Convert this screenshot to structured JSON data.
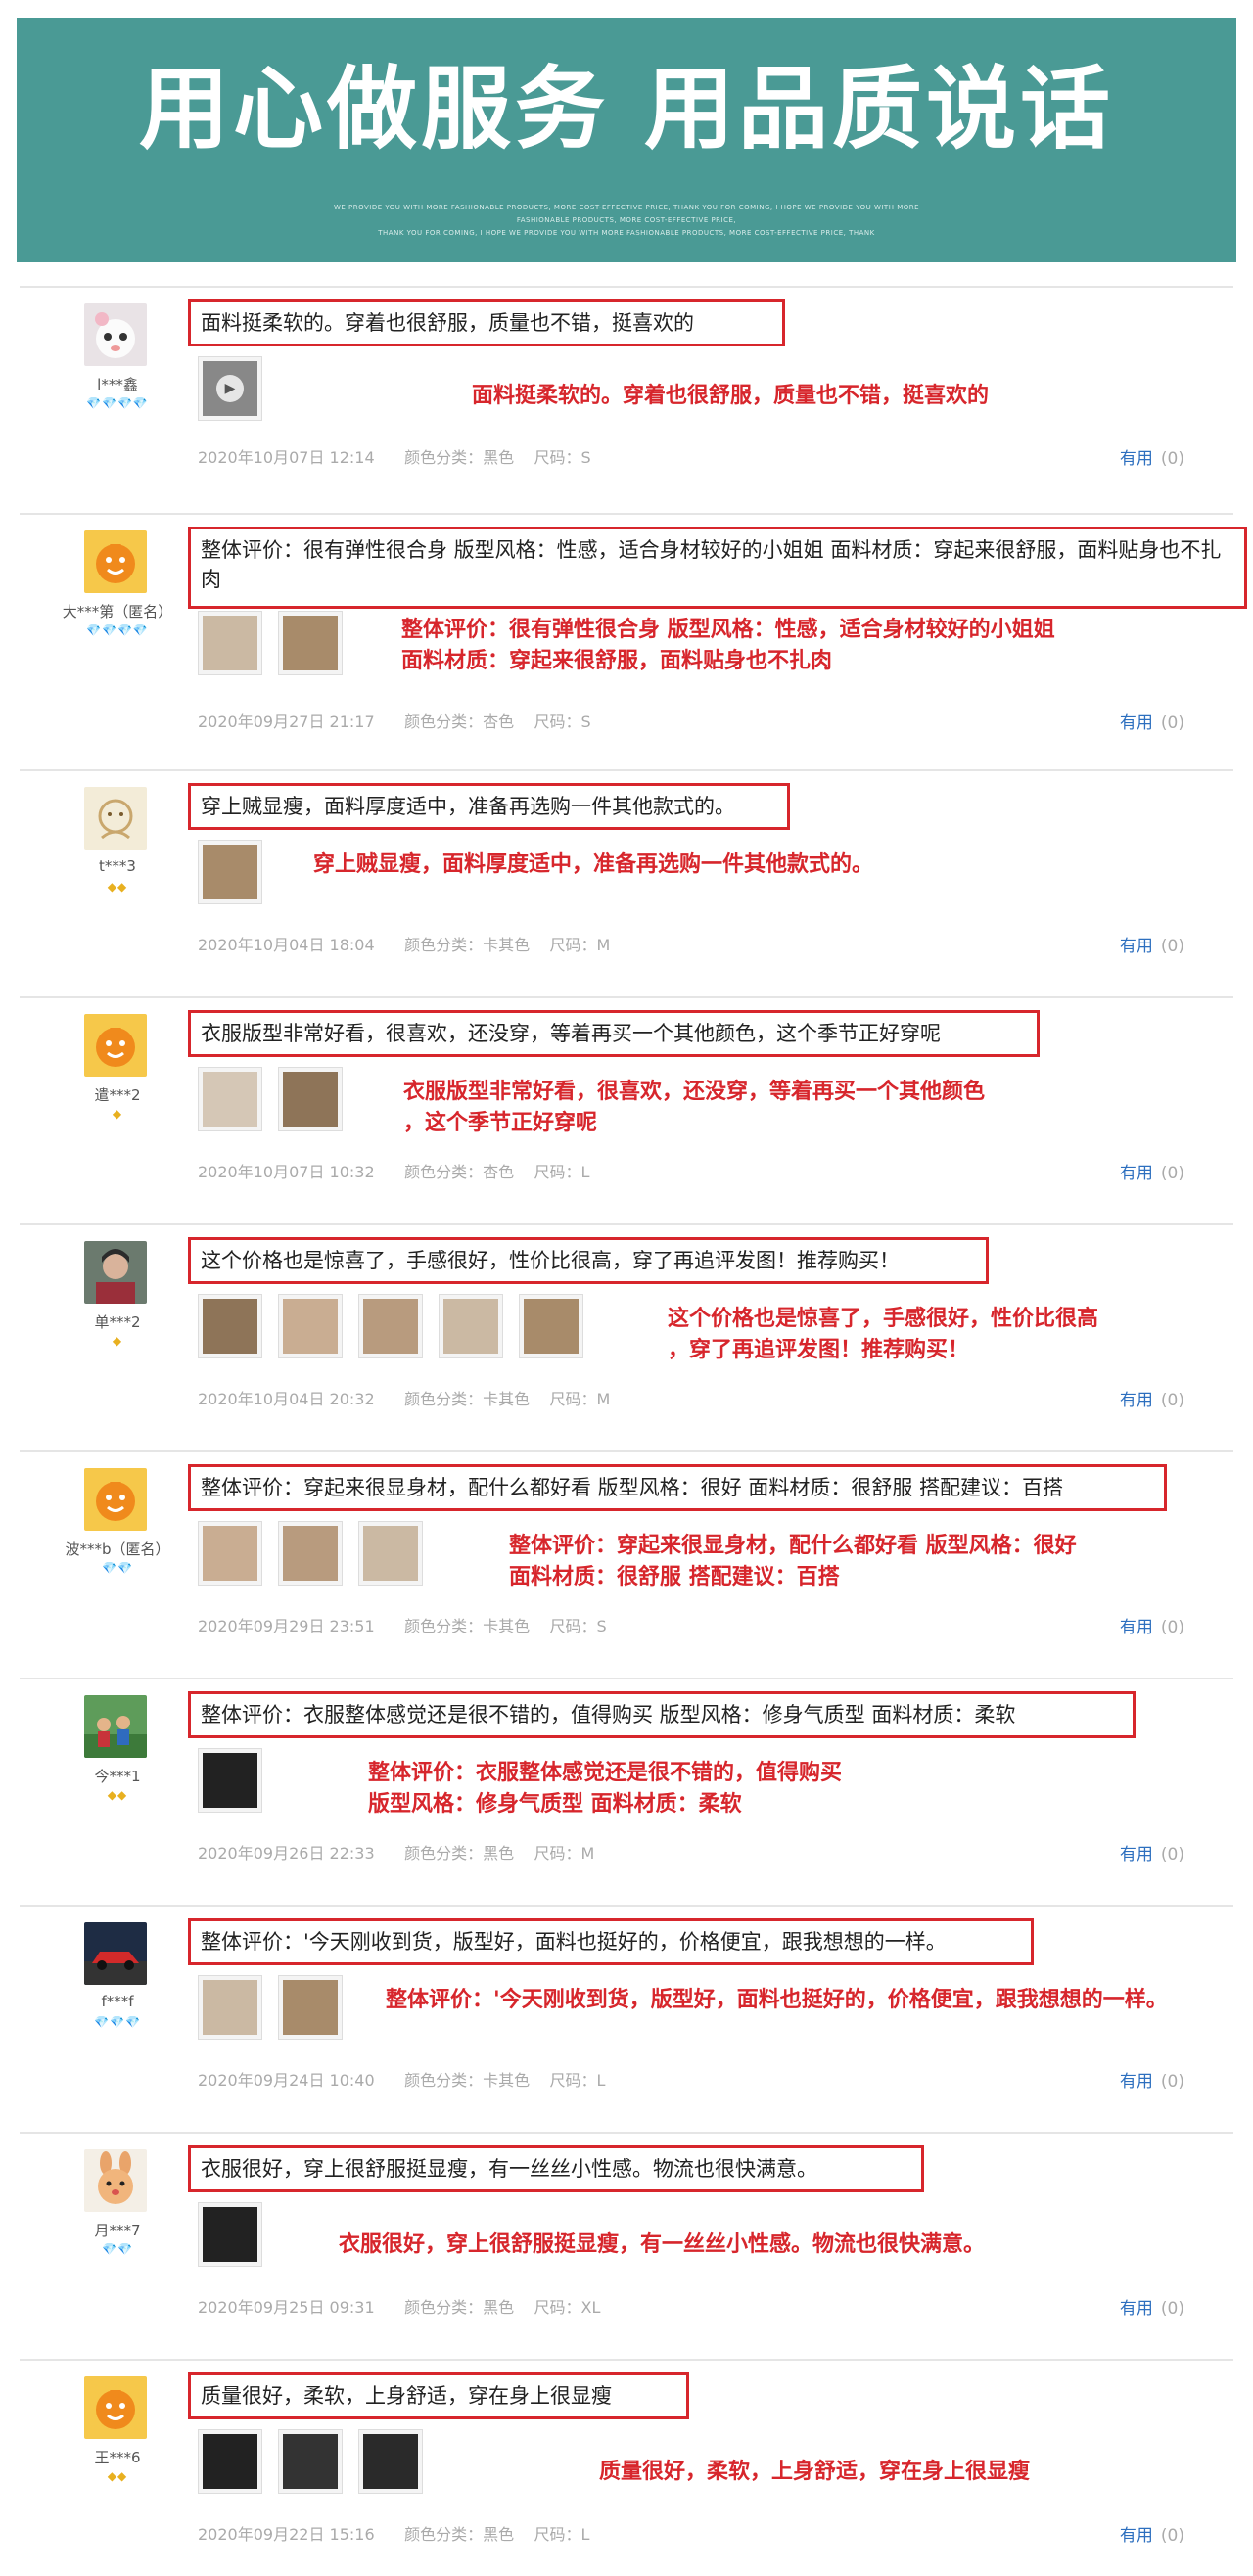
{
  "banner": {
    "title": "用心做服务 用品质说话",
    "sub_lines": [
      "WE PROVIDE YOU WITH MORE FASHIONABLE PRODUCTS, MORE COST-EFFECTIVE PRICE, THANK YOU FOR COMING, I HOPE WE PROVIDE YOU WITH MORE",
      "FASHIONABLE PRODUCTS, MORE COST-EFFECTIVE PRICE,",
      "THANK YOU FOR COMING, I HOPE WE PROVIDE YOU WITH MORE FASHIONABLE PRODUCTS, MORE COST-EFFECTIVE PRICE, THANK"
    ]
  },
  "useful_label": "有用",
  "reviews": [
    {
      "user": "l***鑫",
      "badges": "💎💎💎💎",
      "badge_color": "#e23a3a",
      "comment": "面料挺柔软的。穿着也很舒服，质量也不错，挺喜欢的",
      "annotation": "面料挺柔软的。穿着也很舒服，质量也不错，挺喜欢的",
      "date": "2020年10月07日 12:14",
      "color_label": "颜色分类：",
      "color": "黑色",
      "size_label": "尺码：",
      "size": "S",
      "useful_count": "(0)",
      "thumb_count": 1,
      "video": true,
      "avatar": "cat"
    },
    {
      "user": "大***第（匿名）",
      "badges": "💎💎💎💎",
      "badge_color": "#e23a3a",
      "comment": "整体评价：很有弹性很合身 版型风格：性感，适合身材较好的小姐姐 面料材质：穿起来很舒服，面料贴身也不扎肉",
      "annotation": "整体评价：很有弹性很合身 版型风格：性感，适合身材较好的小姐姐\n面料材质：穿起来很舒服，面料贴身也不扎肉",
      "date": "2020年09月27日 21:17",
      "color_label": "颜色分类：",
      "color": "杏色",
      "size_label": "尺码：",
      "size": "S",
      "useful_count": "(0)",
      "thumb_count": 2,
      "avatar": "default"
    },
    {
      "user": "t***3",
      "badges": "◆◆",
      "badge_color": "#e8b020",
      "comment": "穿上贼显瘦，面料厚度适中，准备再选购一件其他款式的。",
      "annotation": "穿上贼显瘦，面料厚度适中，准备再选购一件其他款式的。",
      "date": "2020年10月04日 18:04",
      "color_label": "颜色分类：",
      "color": "卡其色",
      "size_label": "尺码：",
      "size": "M",
      "useful_count": "(0)",
      "thumb_count": 1,
      "avatar": "sketch"
    },
    {
      "user": "遣***2",
      "badges": "◆",
      "badge_color": "#e8b020",
      "comment": "衣服版型非常好看，很喜欢，还没穿，等着再买一个其他颜色，这个季节正好穿呢",
      "annotation": "衣服版型非常好看，很喜欢，还没穿，等着再买一个其他颜色\n，这个季节正好穿呢",
      "date": "2020年10月07日 10:32",
      "color_label": "颜色分类：",
      "color": "杏色",
      "size_label": "尺码：",
      "size": "L",
      "useful_count": "(0)",
      "thumb_count": 2,
      "avatar": "default"
    },
    {
      "user": "单***2",
      "badges": "◆",
      "badge_color": "#e8b020",
      "comment": "这个价格也是惊喜了，手感很好，性价比很高，穿了再追评发图！推荐购买！",
      "annotation": "这个价格也是惊喜了，手感很好，性价比很高\n，穿了再追评发图！推荐购买！",
      "date": "2020年10月04日 20:32",
      "color_label": "颜色分类：",
      "color": "卡其色",
      "size_label": "尺码：",
      "size": "M",
      "useful_count": "(0)",
      "thumb_count": 5,
      "avatar": "photo"
    },
    {
      "user": "波***b（匿名）",
      "badges": "💎💎",
      "badge_color": "#e23a3a",
      "comment": "整体评价：穿起来很显身材，配什么都好看 版型风格：很好 面料材质：很舒服 搭配建议：百搭",
      "annotation": "整体评价：穿起来很显身材，配什么都好看 版型风格：很好\n面料材质：很舒服 搭配建议：百搭",
      "date": "2020年09月29日 23:51",
      "color_label": "颜色分类：",
      "color": "卡其色",
      "size_label": "尺码：",
      "size": "S",
      "useful_count": "(0)",
      "thumb_count": 3,
      "avatar": "default"
    },
    {
      "user": "今***1",
      "badges": "◆◆",
      "badge_color": "#e8b020",
      "comment": "整体评价：衣服整体感觉还是很不错的，值得购买 版型风格：修身气质型 面料材质：柔软",
      "annotation": "整体评价：衣服整体感觉还是很不错的，值得购买\n版型风格：修身气质型 面料材质：柔软",
      "date": "2020年09月26日 22:33",
      "color_label": "颜色分类：",
      "color": "黑色",
      "size_label": "尺码：",
      "size": "M",
      "useful_count": "(0)",
      "thumb_count": 1,
      "avatar": "group"
    },
    {
      "user": "f***f",
      "badges": "💎💎💎",
      "badge_color": "#e23a3a",
      "comment": "整体评价：'今天刚收到货，版型好，面料也挺好的，价格便宜，跟我想想的一样。",
      "annotation": "整体评价：'今天刚收到货，版型好，面料也挺好的，价格便宜，跟我想想的一样。",
      "date": "2020年09月24日 10:40",
      "color_label": "颜色分类：",
      "color": "卡其色",
      "size_label": "尺码：",
      "size": "L",
      "useful_count": "(0)",
      "thumb_count": 2,
      "avatar": "car"
    },
    {
      "user": "月***7",
      "badges": "💎💎",
      "badge_color": "#e23a3a",
      "comment": "衣服很好，穿上很舒服挺显瘦，有一丝丝小性感。物流也很快满意。",
      "annotation": "衣服很好，穿上很舒服挺显瘦，有一丝丝小性感。物流也很快满意。",
      "date": "2020年09月25日 09:31",
      "color_label": "颜色分类：",
      "color": "黑色",
      "size_label": "尺码：",
      "size": "XL",
      "useful_count": "(0)",
      "thumb_count": 1,
      "avatar": "bunny"
    },
    {
      "user": "王***6",
      "badges": "◆◆",
      "badge_color": "#e8b020",
      "comment": "质量很好，柔软，上身舒适，穿在身上很显瘦",
      "annotation": "质量很好，柔软，上身舒适，穿在身上很显瘦",
      "date": "2020年09月22日 15:16",
      "color_label": "颜色分类：",
      "color": "黑色",
      "size_label": "尺码：",
      "size": "L",
      "useful_count": "(0)",
      "thumb_count": 3,
      "avatar": "default"
    }
  ]
}
